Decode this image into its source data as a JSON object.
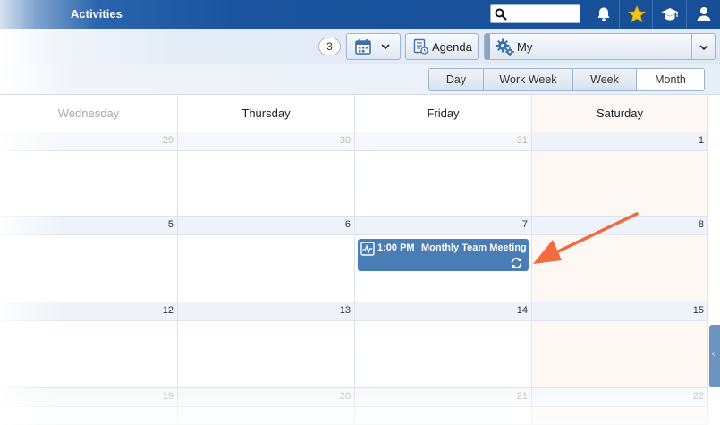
{
  "topbar": {
    "title": "Activities",
    "search": {
      "value": "",
      "placeholder": ""
    },
    "icons": [
      "search-icon",
      "bell-icon",
      "star-icon",
      "graduation-cap-icon",
      "user-icon"
    ],
    "star_color": "#f5c518"
  },
  "toolbar": {
    "count": "3",
    "agenda_label": "Agenda",
    "view_selected": "My"
  },
  "views": {
    "tabs": [
      {
        "label": "Day",
        "active": false
      },
      {
        "label": "Work Week",
        "active": false
      },
      {
        "label": "Week",
        "active": false
      },
      {
        "label": "Month",
        "active": true
      }
    ]
  },
  "calendar": {
    "headers": [
      "Wednesday",
      "Thursday",
      "Friday",
      "Saturday"
    ],
    "weeks": [
      [
        "29",
        "30",
        "31",
        "1"
      ],
      [
        "5",
        "6",
        "7",
        "8"
      ],
      [
        "12",
        "13",
        "14",
        "15"
      ],
      [
        "19",
        "20",
        "21",
        "22"
      ]
    ],
    "event": {
      "time": "1:00 PM",
      "title": "Monthly Team Meeting",
      "color": "#4a7cb5"
    }
  },
  "annotation": {
    "arrow_color": "#f26a3d"
  }
}
